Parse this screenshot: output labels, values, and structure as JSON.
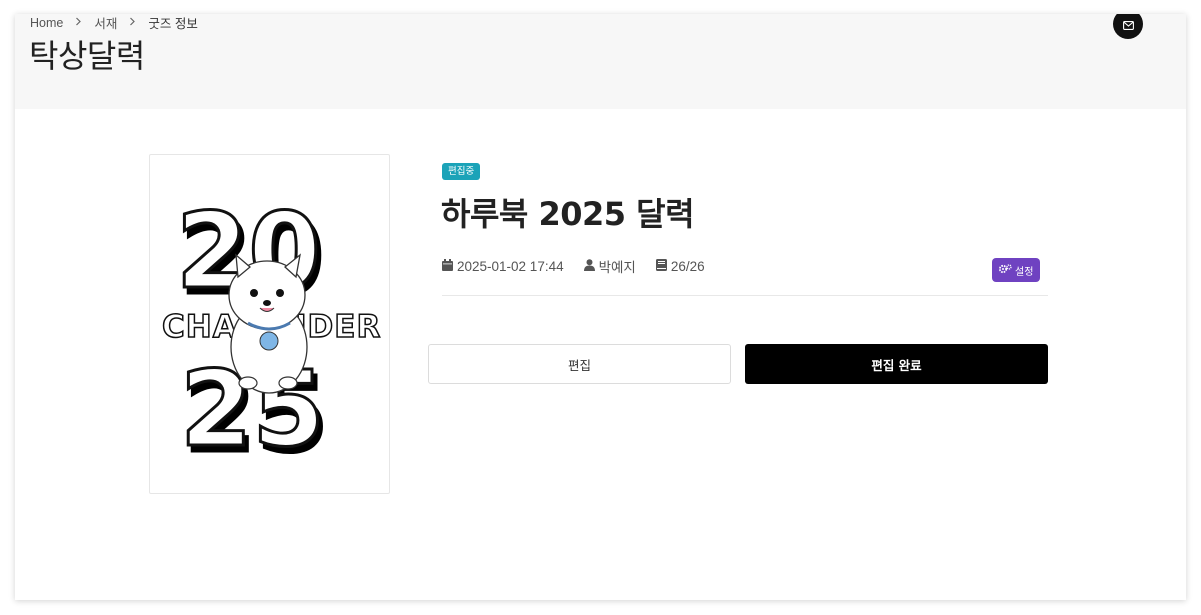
{
  "breadcrumb": {
    "items": [
      "Home",
      "서재",
      "굿즈 정보"
    ]
  },
  "page": {
    "title": "탁상달력"
  },
  "product": {
    "status": "편집중",
    "title": "하루북 2025 달력",
    "date": "2025-01-02 17:44",
    "author": "박예지",
    "pages": "26/26",
    "settings_label": "설정",
    "cover_text": {
      "year_top": "20",
      "word": "CHALENDER",
      "year_bottom": "25"
    }
  },
  "actions": {
    "edit_label": "편집",
    "done_label": "편집 완료"
  },
  "colors": {
    "status_badge": "#1ba3b8",
    "settings_button": "#6f42c1",
    "primary_button": "#000000"
  },
  "icons": [
    "chevron-right-icon",
    "mail-icon",
    "calendar-icon",
    "user-icon",
    "book-icon",
    "gears-icon"
  ]
}
